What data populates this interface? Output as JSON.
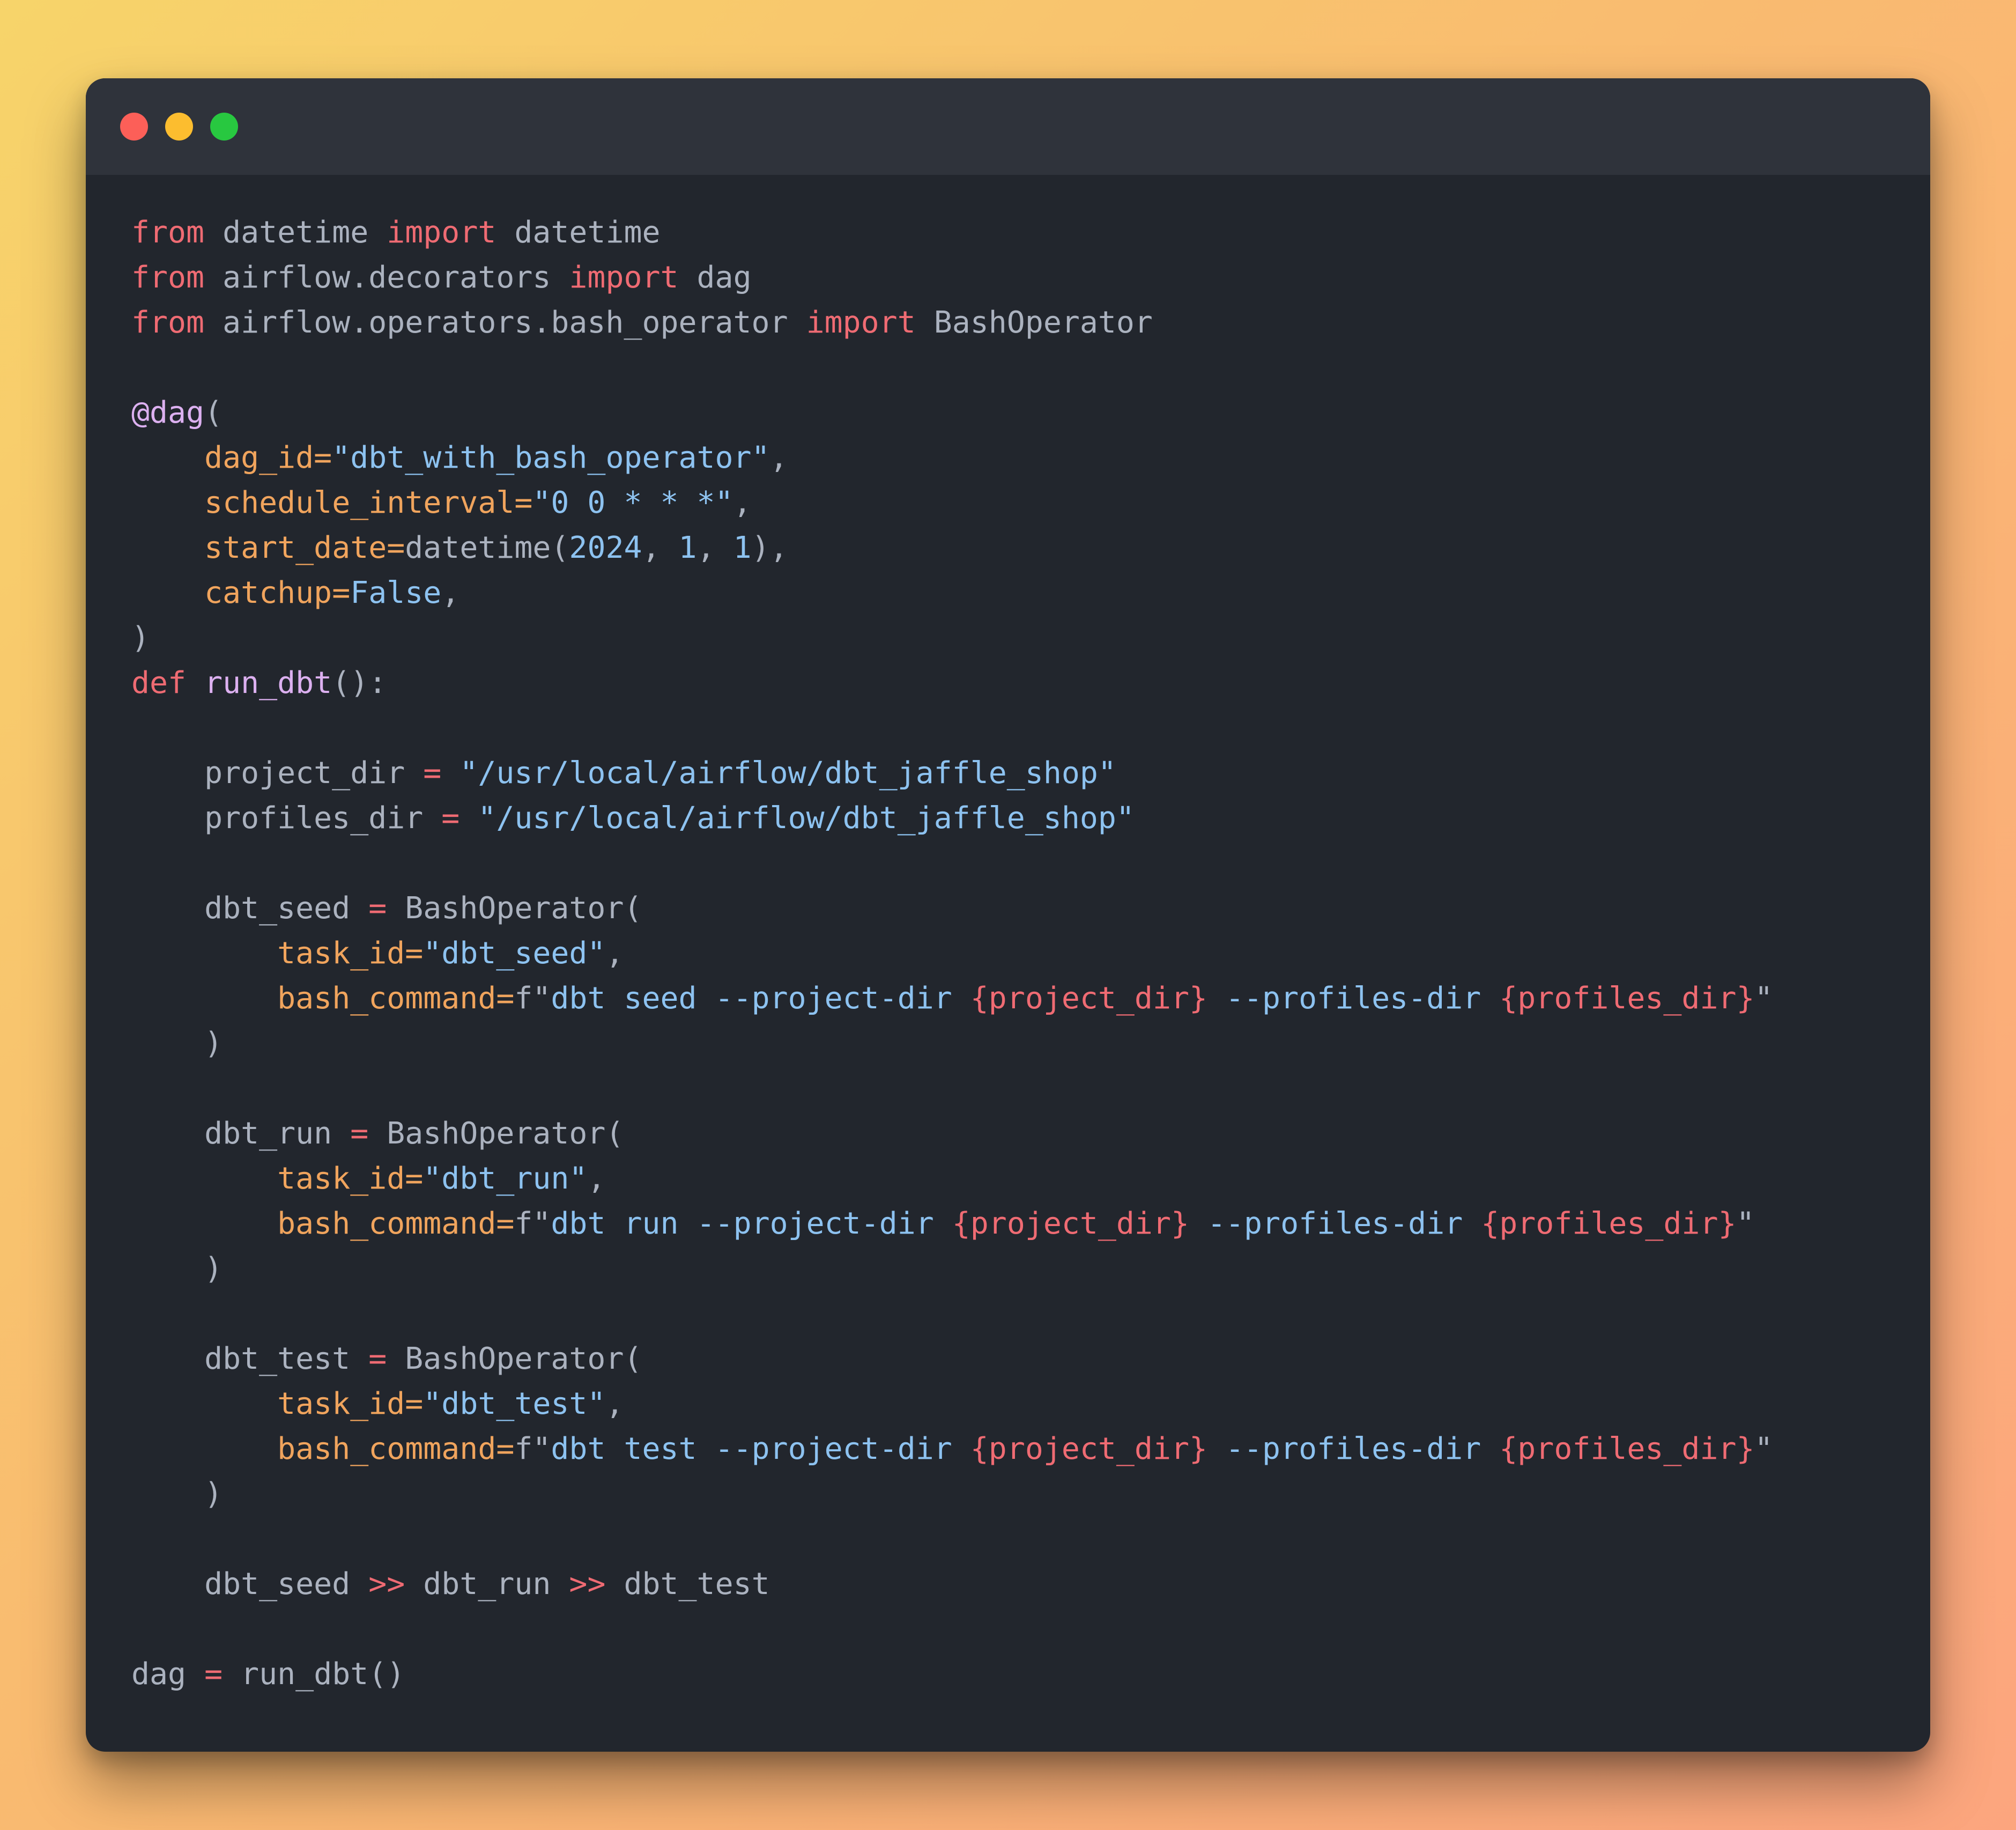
{
  "window": {
    "controls": {
      "close": "close",
      "minimize": "minimize",
      "maximize": "maximize"
    },
    "colors": {
      "close": "#fc5f58",
      "minimize": "#fcbd2f",
      "maximize": "#28c840",
      "background": "#22262d",
      "titlebar": "#2f333b"
    }
  },
  "code": {
    "language": "python",
    "lines": [
      [
        {
          "t": "from",
          "c": "kw"
        },
        {
          "t": " datetime ",
          "c": "id"
        },
        {
          "t": "import",
          "c": "kw"
        },
        {
          "t": " datetime",
          "c": "id"
        }
      ],
      [
        {
          "t": "from",
          "c": "kw"
        },
        {
          "t": " airflow.decorators ",
          "c": "id"
        },
        {
          "t": "import",
          "c": "kw"
        },
        {
          "t": " dag",
          "c": "id"
        }
      ],
      [
        {
          "t": "from",
          "c": "kw"
        },
        {
          "t": " airflow.operators.bash_operator ",
          "c": "id"
        },
        {
          "t": "import",
          "c": "kw"
        },
        {
          "t": " BashOperator",
          "c": "id"
        }
      ],
      [],
      [
        {
          "t": "@dag",
          "c": "fn"
        },
        {
          "t": "(",
          "c": "id"
        }
      ],
      [
        {
          "t": "    ",
          "c": "id"
        },
        {
          "t": "dag_id=",
          "c": "arg"
        },
        {
          "t": "\"dbt_with_bash_operator\"",
          "c": "str"
        },
        {
          "t": ",",
          "c": "id"
        }
      ],
      [
        {
          "t": "    ",
          "c": "id"
        },
        {
          "t": "schedule_interval=",
          "c": "arg"
        },
        {
          "t": "\"0 0 * * *\"",
          "c": "str"
        },
        {
          "t": ",",
          "c": "id"
        }
      ],
      [
        {
          "t": "    ",
          "c": "id"
        },
        {
          "t": "start_date=",
          "c": "arg"
        },
        {
          "t": "datetime(",
          "c": "id"
        },
        {
          "t": "2024",
          "c": "num"
        },
        {
          "t": ", ",
          "c": "id"
        },
        {
          "t": "1",
          "c": "num"
        },
        {
          "t": ", ",
          "c": "id"
        },
        {
          "t": "1",
          "c": "num"
        },
        {
          "t": "),",
          "c": "id"
        }
      ],
      [
        {
          "t": "    ",
          "c": "id"
        },
        {
          "t": "catchup=",
          "c": "arg"
        },
        {
          "t": "False",
          "c": "num"
        },
        {
          "t": ",",
          "c": "id"
        }
      ],
      [
        {
          "t": ")",
          "c": "id"
        }
      ],
      [
        {
          "t": "def",
          "c": "kw"
        },
        {
          "t": " ",
          "c": "id"
        },
        {
          "t": "run_dbt",
          "c": "fn"
        },
        {
          "t": "():",
          "c": "id"
        }
      ],
      [],
      [
        {
          "t": "    project_dir ",
          "c": "id"
        },
        {
          "t": "=",
          "c": "op"
        },
        {
          "t": " ",
          "c": "id"
        },
        {
          "t": "\"/usr/local/airflow/dbt_jaffle_shop\"",
          "c": "str"
        }
      ],
      [
        {
          "t": "    profiles_dir ",
          "c": "id"
        },
        {
          "t": "=",
          "c": "op"
        },
        {
          "t": " ",
          "c": "id"
        },
        {
          "t": "\"/usr/local/airflow/dbt_jaffle_shop\"",
          "c": "str"
        }
      ],
      [],
      [
        {
          "t": "    dbt_seed ",
          "c": "id"
        },
        {
          "t": "=",
          "c": "op"
        },
        {
          "t": " BashOperator(",
          "c": "id"
        }
      ],
      [
        {
          "t": "        ",
          "c": "id"
        },
        {
          "t": "task_id=",
          "c": "arg"
        },
        {
          "t": "\"dbt_seed\"",
          "c": "str"
        },
        {
          "t": ",",
          "c": "id"
        }
      ],
      [
        {
          "t": "        ",
          "c": "id"
        },
        {
          "t": "bash_command=",
          "c": "arg"
        },
        {
          "t": "f\"",
          "c": "id"
        },
        {
          "t": "dbt seed --project-dir ",
          "c": "str"
        },
        {
          "t": "{project_dir}",
          "c": "interp"
        },
        {
          "t": " --profiles-dir ",
          "c": "str"
        },
        {
          "t": "{profiles_dir}",
          "c": "interp"
        },
        {
          "t": "\"",
          "c": "id"
        }
      ],
      [
        {
          "t": "    )",
          "c": "id"
        }
      ],
      [],
      [
        {
          "t": "    dbt_run ",
          "c": "id"
        },
        {
          "t": "=",
          "c": "op"
        },
        {
          "t": " BashOperator(",
          "c": "id"
        }
      ],
      [
        {
          "t": "        ",
          "c": "id"
        },
        {
          "t": "task_id=",
          "c": "arg"
        },
        {
          "t": "\"dbt_run\"",
          "c": "str"
        },
        {
          "t": ",",
          "c": "id"
        }
      ],
      [
        {
          "t": "        ",
          "c": "id"
        },
        {
          "t": "bash_command=",
          "c": "arg"
        },
        {
          "t": "f\"",
          "c": "id"
        },
        {
          "t": "dbt run --project-dir ",
          "c": "str"
        },
        {
          "t": "{project_dir}",
          "c": "interp"
        },
        {
          "t": " --profiles-dir ",
          "c": "str"
        },
        {
          "t": "{profiles_dir}",
          "c": "interp"
        },
        {
          "t": "\"",
          "c": "id"
        }
      ],
      [
        {
          "t": "    )",
          "c": "id"
        }
      ],
      [],
      [
        {
          "t": "    dbt_test ",
          "c": "id"
        },
        {
          "t": "=",
          "c": "op"
        },
        {
          "t": " BashOperator(",
          "c": "id"
        }
      ],
      [
        {
          "t": "        ",
          "c": "id"
        },
        {
          "t": "task_id=",
          "c": "arg"
        },
        {
          "t": "\"dbt_test\"",
          "c": "str"
        },
        {
          "t": ",",
          "c": "id"
        }
      ],
      [
        {
          "t": "        ",
          "c": "id"
        },
        {
          "t": "bash_command=",
          "c": "arg"
        },
        {
          "t": "f\"",
          "c": "id"
        },
        {
          "t": "dbt test --project-dir ",
          "c": "str"
        },
        {
          "t": "{project_dir}",
          "c": "interp"
        },
        {
          "t": " --profiles-dir ",
          "c": "str"
        },
        {
          "t": "{profiles_dir}",
          "c": "interp"
        },
        {
          "t": "\"",
          "c": "id"
        }
      ],
      [
        {
          "t": "    )",
          "c": "id"
        }
      ],
      [],
      [
        {
          "t": "    dbt_seed ",
          "c": "id"
        },
        {
          "t": ">>",
          "c": "op"
        },
        {
          "t": " dbt_run ",
          "c": "id"
        },
        {
          "t": ">>",
          "c": "op"
        },
        {
          "t": " dbt_test",
          "c": "id"
        }
      ],
      [],
      [
        {
          "t": "dag ",
          "c": "id"
        },
        {
          "t": "=",
          "c": "op"
        },
        {
          "t": " run_dbt()",
          "c": "id"
        }
      ]
    ]
  }
}
